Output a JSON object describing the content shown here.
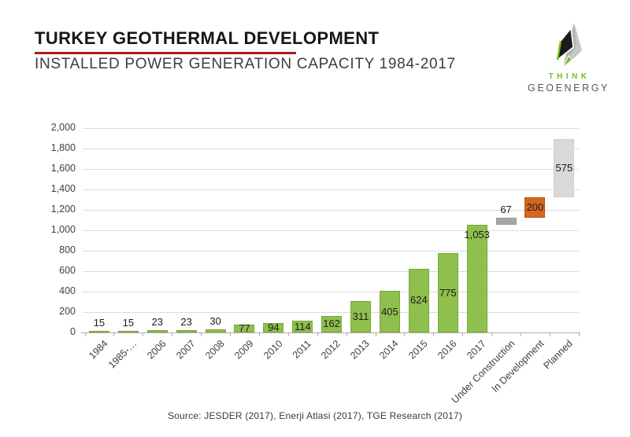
{
  "header": {
    "title": "TURKEY GEOTHERMAL DEVELOPMENT",
    "subtitle": "INSTALLED POWER GENERATION CAPACITY 1984-2017",
    "underline_color": "#A81E1E"
  },
  "logo": {
    "line1": "THINK",
    "line2": "GEOENERGY",
    "green": "#76B82A",
    "gray": "#55565A"
  },
  "source": "Source: JESDER (2017), Enerji Atlasi (2017), TGE Research (2017)",
  "chart_data": {
    "type": "bar",
    "subtype": "waterfall-extension",
    "ylim": [
      0,
      2000
    ],
    "ytick_step": 200,
    "yticks": [
      "0",
      "200",
      "400",
      "600",
      "800",
      "1,000",
      "1,200",
      "1,400",
      "1,600",
      "1,800",
      "2,000"
    ],
    "grid": true,
    "legend": false,
    "categories": [
      "1984",
      "1985-…",
      "2006",
      "2007",
      "2008",
      "2009",
      "2010",
      "2011",
      "2012",
      "2013",
      "2014",
      "2015",
      "2016",
      "2017",
      "Under Construction",
      "In Development",
      "Planned"
    ],
    "bars": [
      {
        "category": "1984",
        "value": 15,
        "display": "15",
        "base": 0,
        "type": "installed"
      },
      {
        "category": "1985-…",
        "value": 15,
        "display": "15",
        "base": 0,
        "type": "installed"
      },
      {
        "category": "2006",
        "value": 23,
        "display": "23",
        "base": 0,
        "type": "installed"
      },
      {
        "category": "2007",
        "value": 23,
        "display": "23",
        "base": 0,
        "type": "installed"
      },
      {
        "category": "2008",
        "value": 30,
        "display": "30",
        "base": 0,
        "type": "installed"
      },
      {
        "category": "2009",
        "value": 77,
        "display": "77",
        "base": 0,
        "type": "installed"
      },
      {
        "category": "2010",
        "value": 94,
        "display": "94",
        "base": 0,
        "type": "installed"
      },
      {
        "category": "2011",
        "value": 114,
        "display": "114",
        "base": 0,
        "type": "installed"
      },
      {
        "category": "2012",
        "value": 162,
        "display": "162",
        "base": 0,
        "type": "installed"
      },
      {
        "category": "2013",
        "value": 311,
        "display": "311",
        "base": 0,
        "type": "installed"
      },
      {
        "category": "2014",
        "value": 405,
        "display": "405",
        "base": 0,
        "type": "installed"
      },
      {
        "category": "2015",
        "value": 624,
        "display": "624",
        "base": 0,
        "type": "installed"
      },
      {
        "category": "2016",
        "value": 775,
        "display": "775",
        "base": 0,
        "type": "installed"
      },
      {
        "category": "2017",
        "value": 1053,
        "display": "1,053",
        "base": 0,
        "type": "installed",
        "label_pos": "top"
      },
      {
        "category": "Under Construction",
        "value": 67,
        "display": "67",
        "base": 1053,
        "type": "under_construction"
      },
      {
        "category": "In Development",
        "value": 200,
        "display": "200",
        "base": 1120,
        "type": "in_development"
      },
      {
        "category": "Planned",
        "value": 575,
        "display": "575",
        "base": 1320,
        "type": "planned"
      }
    ],
    "colors": {
      "installed": "#8FBF4D",
      "installed_border": "#7BA83B",
      "under_construction": "#A6A6A6",
      "under_construction_border": "#9B9B9B",
      "in_development": "#D4671E",
      "in_development_border": "#BC4F0E",
      "planned": "#D9D9D9",
      "planned_border": "#CFCFCF"
    }
  }
}
